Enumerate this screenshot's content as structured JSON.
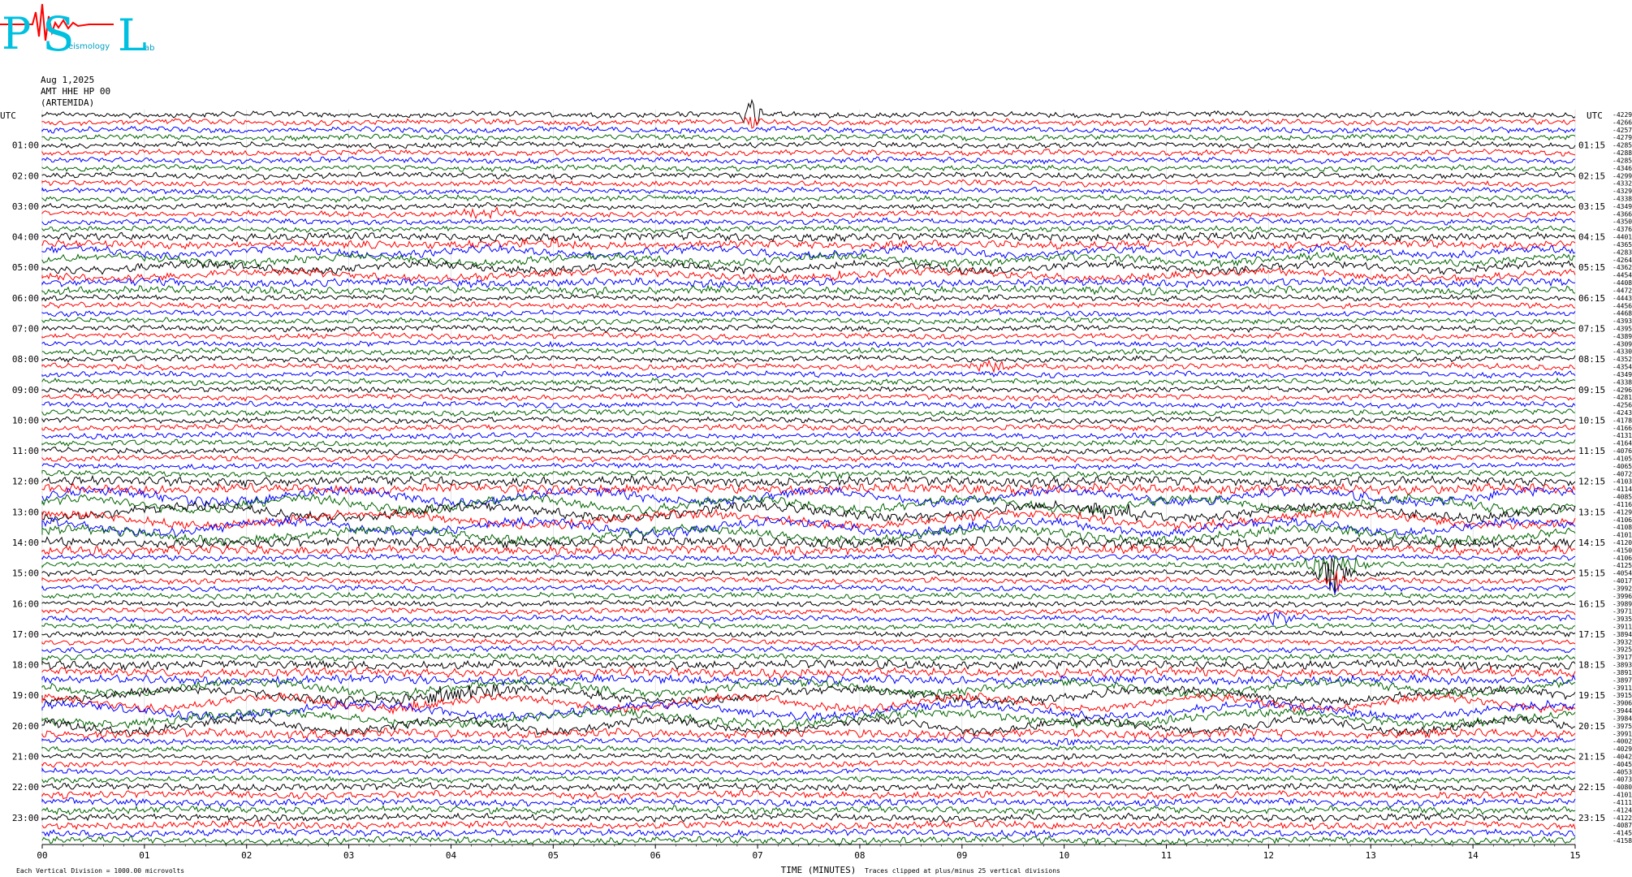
{
  "header": {
    "date": "Aug 1,2025",
    "station": "AMT HHE HP 00",
    "site": "(ARTEMIDA)"
  },
  "logo": {
    "letters": [
      "P",
      "S",
      "L"
    ],
    "subtext": [
      "eismology",
      "ab"
    ]
  },
  "colors": {
    "series": [
      "#000000",
      "#ff0000",
      "#0000ff",
      "#006400"
    ]
  },
  "chart_data": {
    "type": "line",
    "title": "",
    "xlabel": "TIME (MINUTES)",
    "left_label": "UTC",
    "right_label": "UTC",
    "xlim": [
      0,
      15
    ],
    "x_ticks": [
      "00",
      "01",
      "02",
      "03",
      "04",
      "05",
      "06",
      "07",
      "08",
      "09",
      "10",
      "11",
      "12",
      "13",
      "14",
      "15"
    ],
    "left_hour_labels": [
      "01:00",
      "02:00",
      "03:00",
      "04:00",
      "05:00",
      "06:00",
      "07:00",
      "08:00",
      "09:00",
      "10:00",
      "11:00",
      "12:00",
      "13:00",
      "14:00",
      "15:00",
      "16:00",
      "17:00",
      "18:00",
      "19:00",
      "20:00",
      "21:00",
      "22:00",
      "23:00"
    ],
    "right_hour_labels": [
      "01:15",
      "02:15",
      "03:15",
      "04:15",
      "05:15",
      "06:15",
      "07:15",
      "08:15",
      "09:15",
      "10:15",
      "11:15",
      "12:15",
      "13:15",
      "14:15",
      "15:15",
      "16:15",
      "17:15",
      "18:15",
      "19:15",
      "20:15",
      "21:15",
      "22:15",
      "23:15"
    ],
    "traces_per_hour": 4,
    "trace_count": 96,
    "right_values": [
      "-4229",
      "-4266",
      "-4257",
      "-4279",
      "-4285",
      "-4288",
      "-4285",
      "-4346",
      "-4299",
      "-4332",
      "-4329",
      "-4338",
      "-4349",
      "-4366",
      "-4350",
      "-4376",
      "-4401",
      "-4365",
      "-4283",
      "-4264",
      "-4362",
      "-4454",
      "-4408",
      "-4472",
      "-4443",
      "-4456",
      "-4468",
      "-4393",
      "-4395",
      "-4389",
      "-4309",
      "-4330",
      "-4352",
      "-4354",
      "-4349",
      "-4338",
      "-4296",
      "-4281",
      "-4256",
      "-4243",
      "-4178",
      "-4166",
      "-4131",
      "-4164",
      "-4076",
      "-4105",
      "-4065",
      "-4072",
      "-4103",
      "-4114",
      "-4085",
      "-4116",
      "-4129",
      "-4106",
      "-4108",
      "-4101",
      "-4120",
      "-4150",
      "-4106",
      "-4125",
      "-4054",
      "-4017",
      "-3992",
      "-3996",
      "-3989",
      "-3971",
      "-3935",
      "-3911",
      "-3894",
      "-3932",
      "-3925",
      "-3917",
      "-3893",
      "-3891",
      "-3897",
      "-3911",
      "-3915",
      "-3906",
      "-3944",
      "-3984",
      "-3975",
      "-3991",
      "-4002",
      "-4029",
      "-4042",
      "-4045",
      "-4053",
      "-4073",
      "-4080",
      "-4101",
      "-4111",
      "-4124",
      "-4122",
      "-4087",
      "-4145",
      "-4158"
    ],
    "scale_note": "Each Vertical Division = 1000.00 microvolts",
    "clip_note": "Traces clipped at plus/minus 25 vertical divisions",
    "series_colors_cycle": [
      "black",
      "red",
      "blue",
      "green"
    ]
  }
}
